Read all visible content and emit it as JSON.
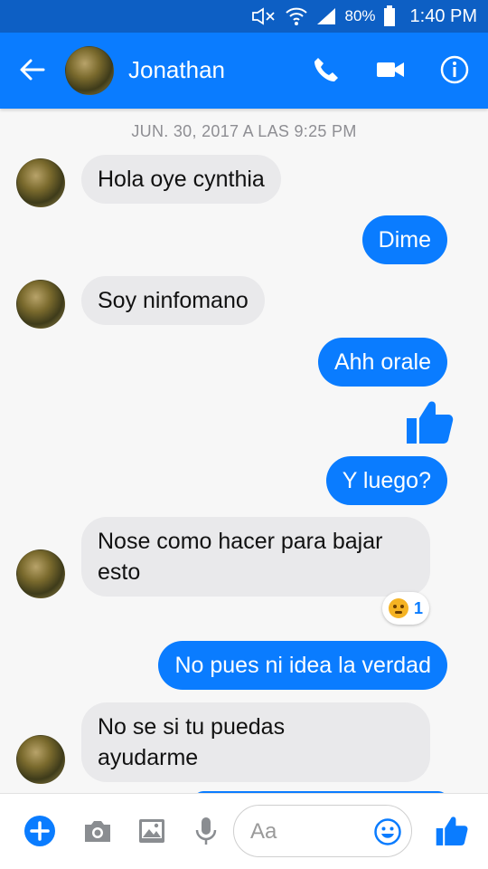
{
  "status_bar": {
    "battery": "80%",
    "time": "1:40 PM"
  },
  "header": {
    "contact_name": "Jonathan"
  },
  "conversation": {
    "date_separator": "JUN. 30, 2017 A LAS 9:25 PM",
    "messages": [
      {
        "from": "them",
        "text": "Hola oye cynthia"
      },
      {
        "from": "me",
        "text": "Dime"
      },
      {
        "from": "them",
        "text": "Soy ninfomano"
      },
      {
        "from": "me",
        "text": "Ahh orale"
      },
      {
        "from": "me",
        "type": "like"
      },
      {
        "from": "me",
        "text": "Y luego?"
      },
      {
        "from": "them",
        "text": "Nose como hacer para bajar\nesto",
        "reaction": {
          "emoji": "angry",
          "count": "1"
        }
      },
      {
        "from": "me",
        "text": "No pues ni idea la verdad"
      },
      {
        "from": "them",
        "text": "No se si tu puedas\nayudarme"
      }
    ]
  },
  "composer": {
    "placeholder": "Aa"
  },
  "colors": {
    "primary": "#0a7cff",
    "status_bar": "#0d5fc4",
    "incoming_bubble": "#e9e9eb"
  }
}
